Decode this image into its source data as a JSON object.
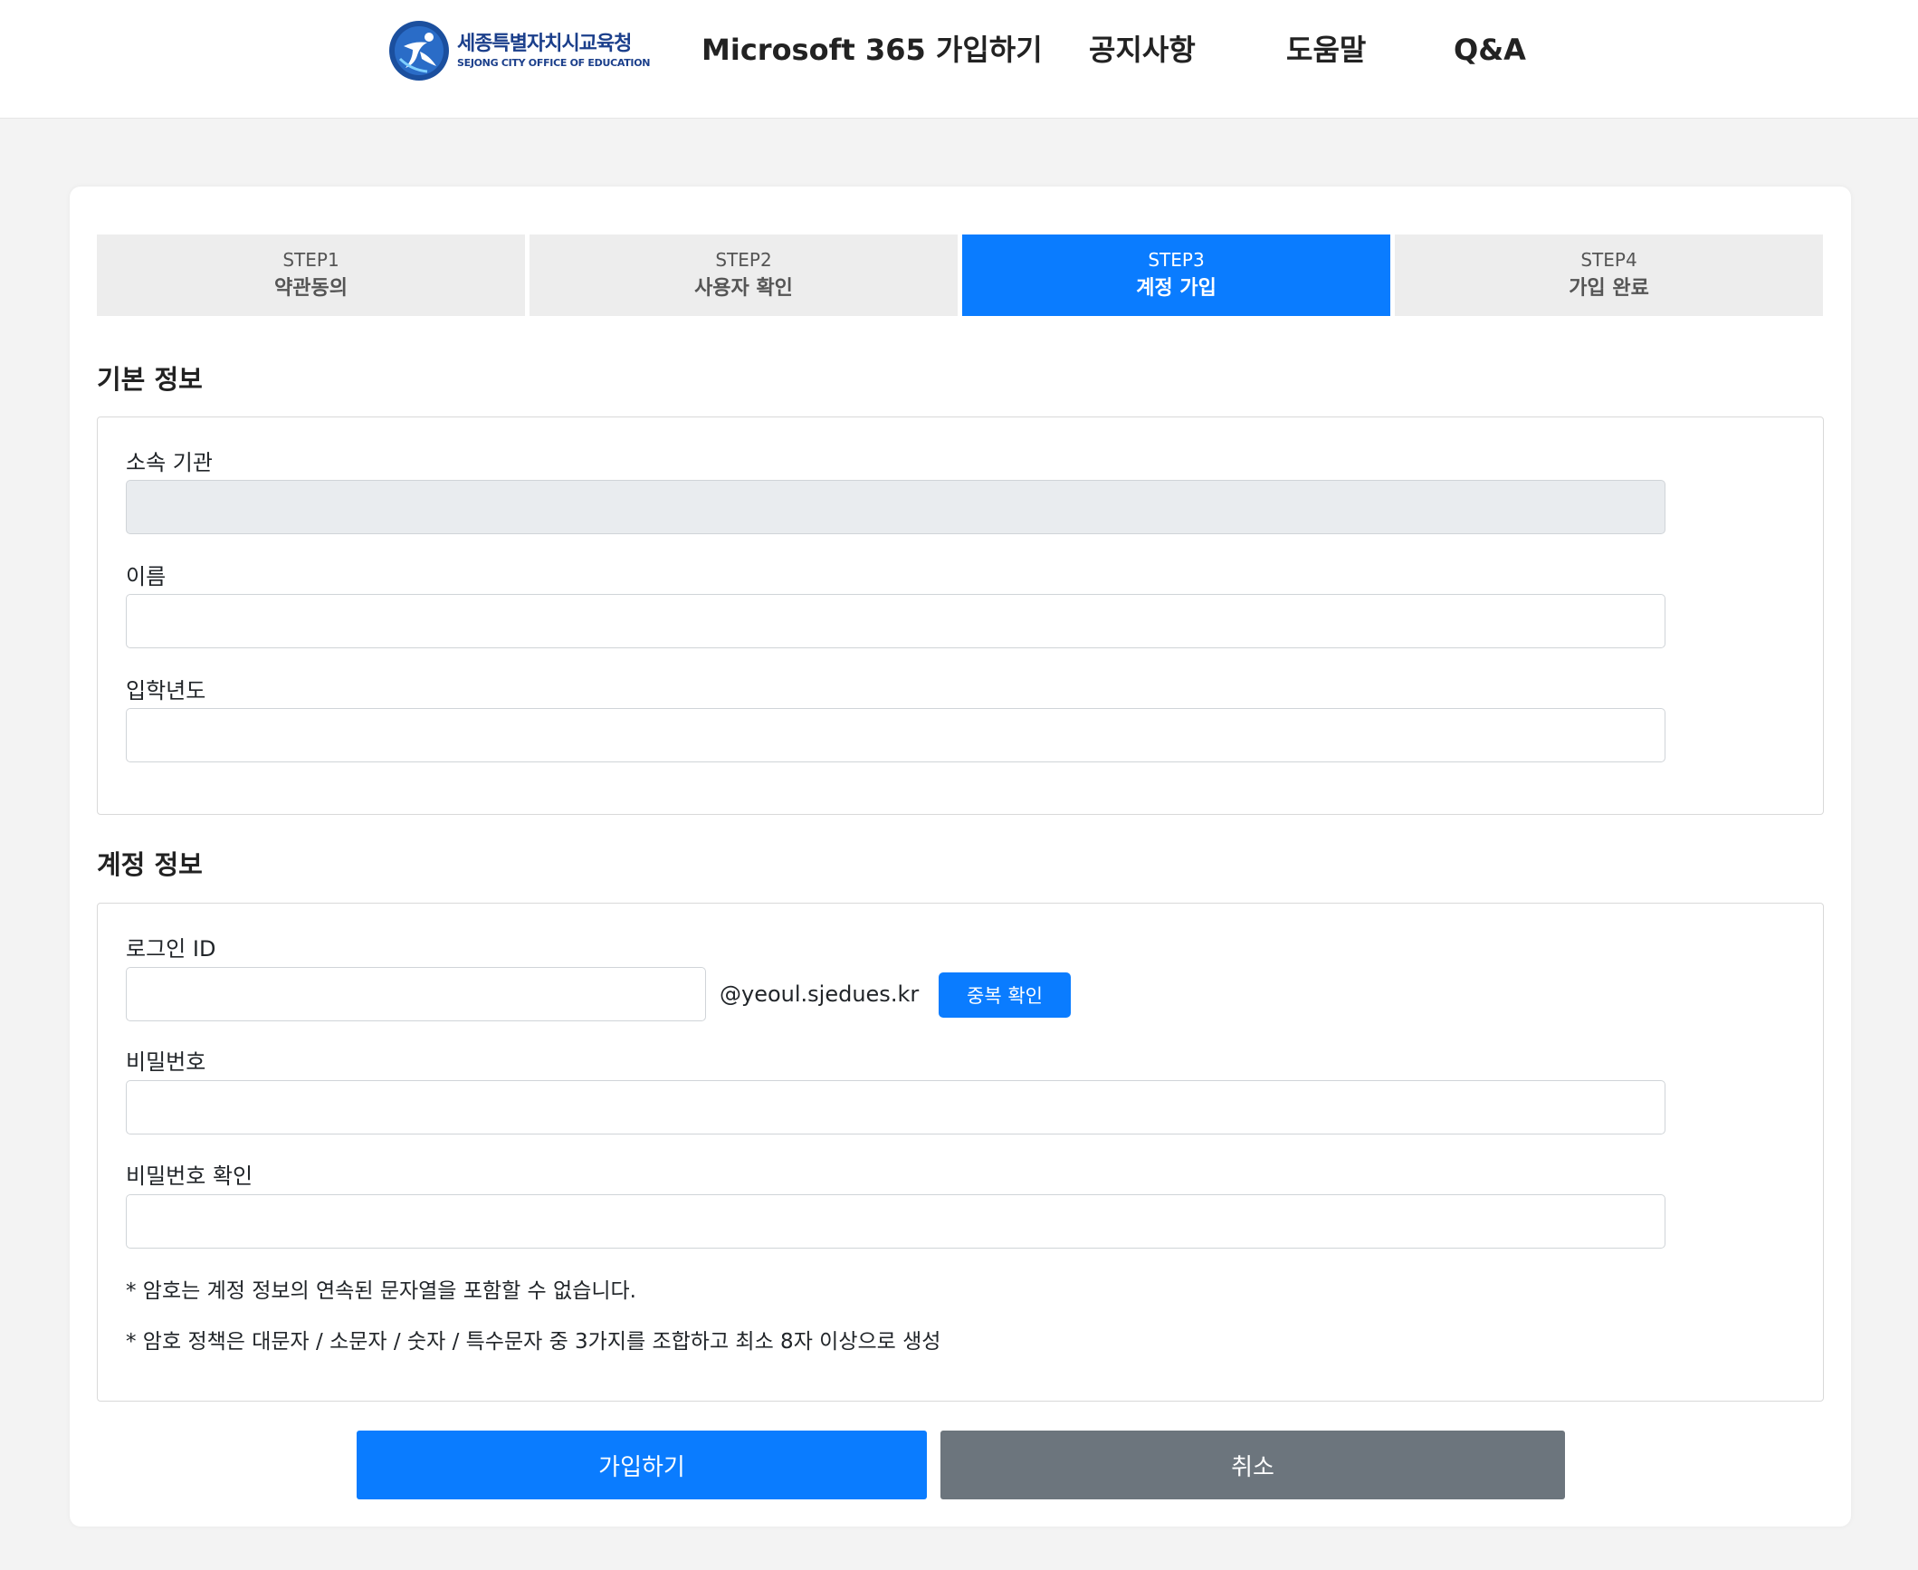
{
  "header": {
    "logo": {
      "name_ko": "세종특별자치시교육청",
      "name_en": "SEJONG CITY OFFICE OF EDUCATION"
    },
    "nav": [
      "Microsoft 365 가입하기",
      "공지사항",
      "도움말",
      "Q&A"
    ]
  },
  "steps": [
    {
      "num": "STEP1",
      "title": "약관동의",
      "active": false
    },
    {
      "num": "STEP2",
      "title": "사용자 확인",
      "active": false
    },
    {
      "num": "STEP3",
      "title": "계정 가입",
      "active": true
    },
    {
      "num": "STEP4",
      "title": "가입 완료",
      "active": false
    }
  ],
  "basic": {
    "title": "기본 정보",
    "org_label": "소속 기관",
    "name_label": "이름",
    "year_label": "입학년도"
  },
  "account": {
    "title": "계정 정보",
    "id_label": "로그인 ID",
    "domain": "@yeoul.sjedues.kr",
    "check_button": "중복 확인",
    "pw_label": "비밀번호",
    "pw_confirm_label": "비밀번호 확인",
    "notes": [
      "* 암호는 계정 정보의 연속된 문자열을 포함할 수 없습니다.",
      "* 암호 정책은 대문자 / 소문자 / 숫자 / 특수문자 중 3가지를 조합하고 최소 8자 이상으로 생성"
    ]
  },
  "actions": {
    "submit": "가입하기",
    "cancel": "취소"
  },
  "colors": {
    "primary": "#0a7cff",
    "secondary": "#6c757d",
    "step_inactive": "#ededed",
    "logo_blue": "#1b3f8b"
  }
}
